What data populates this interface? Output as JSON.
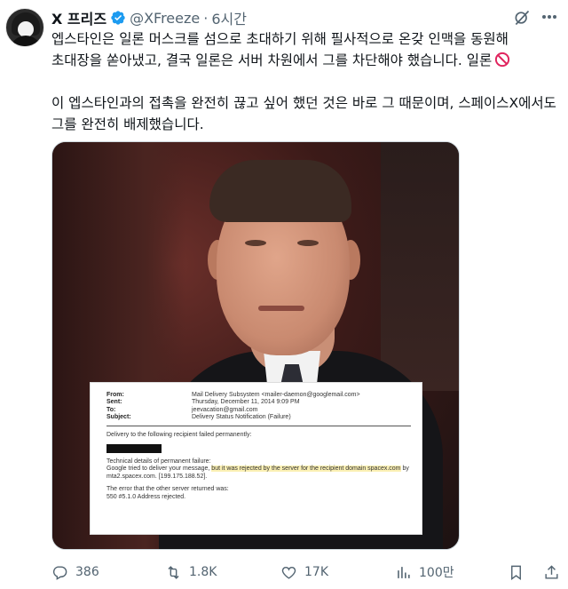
{
  "tweet": {
    "author_name": "X 프리즈",
    "handle": "@XFreeze",
    "separator": "·",
    "time": "6시간",
    "paragraph1": "엡스타인은 일론 머스크를 섬으로 초대하기 위해 필사적으로 온갖 인맥을 동원해 초대장을 쏟아냈고, 결국 일론은 서버 차원에서 그를 차단해야 했습니다. 일론",
    "paragraph2": "이 엡스타인과의 접촉을 완전히 끊고 싶어 했던 것은 바로 그 때문이며, 스페이스X에서도 그를 완전히 배제했습니다.",
    "paragraph1_emoji": "no-entry-icon"
  },
  "email": {
    "from_label": "From:",
    "from_value": "Mail Delivery Subsystem <mailer-daemon@googlemail.com>",
    "sent_label": "Sent:",
    "sent_value": "Thursday, December 11, 2014 9:09 PM",
    "to_label": "To:",
    "to_value": "jeevacation@gmail.com",
    "subject_label": "Subject:",
    "subject_value": "Delivery Status Notification (Failure)",
    "line1": "Delivery to the following recipient failed permanently:",
    "details_title": "Technical details of permanent failure:",
    "details_a": "Google tried to deliver your message, ",
    "details_b": "but it was rejected by the server for the recipient domain spacex.com",
    "details_c": " by mta2.spacex.com. [199.175.188.52].",
    "error_title": "The error that the other server returned was:",
    "error_code": "550 #5.1.0 Address rejected."
  },
  "actions": {
    "replies": "386",
    "reposts": "1.8K",
    "likes": "17K",
    "views": "100만"
  },
  "colors": {
    "verified_blue": "#1d9bf0",
    "muted_gray": "#536471",
    "text": "#0f1419",
    "highlight": "#fbf0b4"
  },
  "icons": [
    "verified-badge-icon",
    "grok-icon",
    "more-icon",
    "reply-icon",
    "repost-icon",
    "like-icon",
    "views-icon",
    "bookmark-icon",
    "share-icon",
    "no-entry-icon"
  ]
}
